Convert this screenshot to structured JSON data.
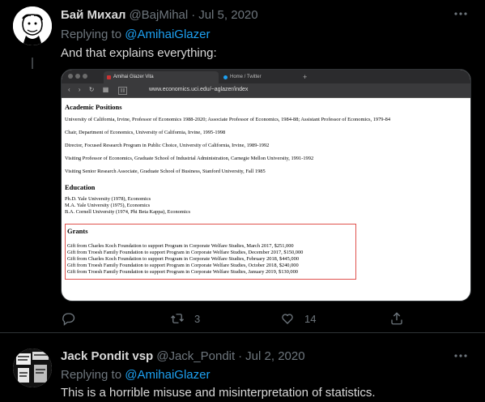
{
  "tweets": [
    {
      "display_name": "Бай Михал",
      "handle": "@BajMihal",
      "separator": "·",
      "date": "Jul 5, 2020",
      "replying_prefix": "Replying to",
      "replying_to": "@AmihaiGlazer",
      "text": "And that explains everything:",
      "embed": {
        "tabs": [
          "Amihai Glazer Vita",
          "Home / Twitter"
        ],
        "new_tab": "+",
        "reader_badge": "||||",
        "url": "www.economics.uci.edu/~aglazer/index",
        "academic_heading": "Academic Positions",
        "academic_items": [
          "University of California, Irvine, Professor of Economics 1988-2020; Associate Professor of Economics, 1984-88; Assistant Professor of Economics, 1979-84",
          "Chair, Department of Economics, University of California, Irvine, 1995-1998",
          "Director, Focused Research Program in Public Choice, University of California, Irvine, 1989-1992",
          "Visiting Professor of Economics, Graduate School of Industrial Administration, Carnegie Mellon University, 1991-1992",
          "Visiting Senior Research Associate, Graduate School of Business, Stanford University, Fall 1985"
        ],
        "education_heading": "Education",
        "education_items": [
          "Ph.D. Yale University (1978), Economics",
          "M.A. Yale University (1975), Economics",
          "B.A. Cornell University (1974, Phi Beta Kappa), Economics"
        ],
        "grants_heading": "Grants",
        "grants_items": [
          "Gift from Charles Koch Foundation to support Program in Corporate Welfare Studies, March 2017, $251,000",
          "Gift from Troesh Family Foundation to support Program in Corporate Welfare Studies, December 2017, $150,000",
          "Gift from Charles Koch Foundation to support Program in Corporate Welfare Studies, February 2018, $445,000",
          "Gift from Troesh Family Foundation to support Program in Corporate Welfare Studies, October 2018, $240,000",
          "Gift from Troesh Family Foundation to support Program in Corporate Welfare Studies, January 2019, $130,000"
        ]
      },
      "actions": {
        "reply_count": "",
        "retweet_count": "3",
        "like_count": "14"
      }
    },
    {
      "display_name": "Jack Pondit vsp",
      "handle": "@Jack_Pondit",
      "separator": "·",
      "date": "Jul 2, 2020",
      "replying_prefix": "Replying to",
      "replying_to": "@AmihaiGlazer",
      "text": "This is a horrible misuse and misinterpretation of statistics."
    }
  ],
  "colors": {
    "background": "#000000",
    "link": "#1da1f2",
    "muted": "#6e767d",
    "highlight_box": "#e0524d"
  },
  "icons": [
    "more-icon",
    "reply-icon",
    "retweet-icon",
    "like-icon",
    "share-icon"
  ]
}
